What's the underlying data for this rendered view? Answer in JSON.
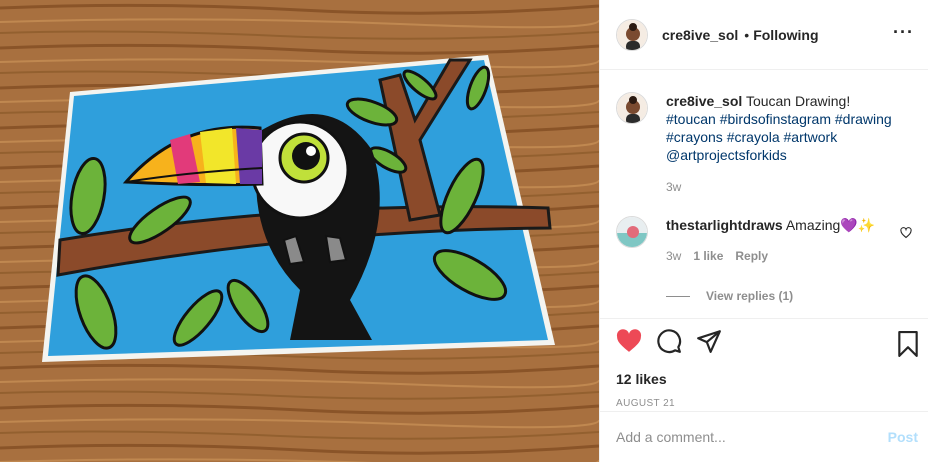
{
  "post": {
    "username": "cre8ive_sol",
    "separator": "•",
    "follow_status": "Following",
    "more_icon": "more-options-icon"
  },
  "caption": {
    "username": "cre8ive_sol",
    "text": "Toucan Drawing!",
    "hashtags": [
      "#toucan",
      "#birdsofinstagram",
      "#drawing",
      "#crayons",
      "#crayola",
      "#artwork"
    ],
    "mention": "@artprojectsforkids",
    "age": "3w"
  },
  "comment": {
    "username": "thestarlightdraws",
    "text": "Amazing💜✨",
    "age": "3w",
    "likes": "1 like",
    "reply": "Reply",
    "view_replies": "View replies (1)"
  },
  "actions": {
    "like_icon": "heart-filled-icon",
    "comment_icon": "comment-icon",
    "share_icon": "share-icon",
    "save_icon": "bookmark-icon",
    "like_color": "#ed4956",
    "likes": "12 likes",
    "date": "AUGUST 21"
  },
  "add_comment": {
    "placeholder": "Add a comment...",
    "post_label": "Post"
  }
}
